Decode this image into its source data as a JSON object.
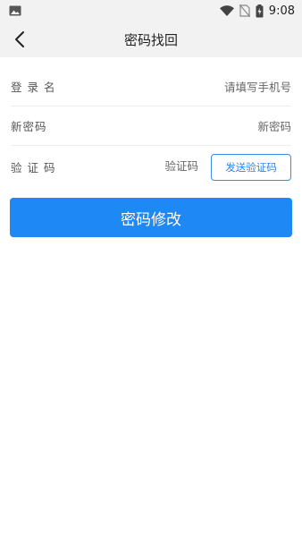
{
  "status_bar": {
    "time": "9:08",
    "icons": [
      "gallery-icon",
      "wifi-icon",
      "no-sim-icon",
      "battery-charging-icon"
    ]
  },
  "nav": {
    "title": "密码找回",
    "back_icon": "chevron-left-icon"
  },
  "form": {
    "username": {
      "label": "登 录 名",
      "value": "",
      "placeholder": "请填写手机号"
    },
    "new_password": {
      "label": "新密码",
      "value": "",
      "placeholder": "新密码"
    },
    "code": {
      "label": "验 证 码",
      "value": "",
      "placeholder": "验证码",
      "send_label": "发送验证码"
    }
  },
  "submit_label": "密码修改",
  "colors": {
    "accent": "#1e88f5",
    "outline_button": "#3a8ee8",
    "header_bg": "#f2f2f2"
  }
}
